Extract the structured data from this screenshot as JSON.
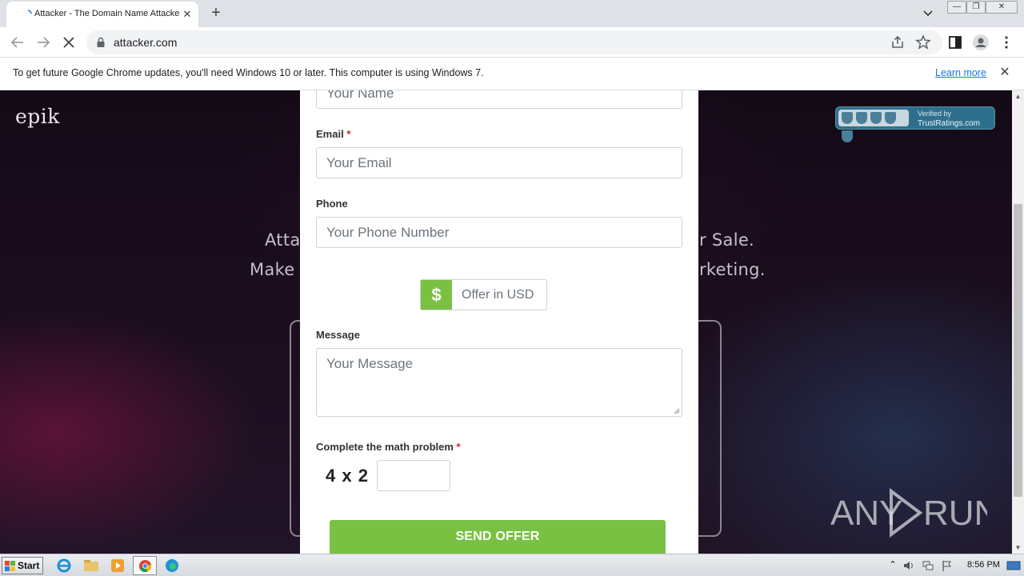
{
  "browser": {
    "tab_title": "Attacker - The Domain Name Attacker",
    "new_tab_symbol": "+",
    "tab_close_symbol": "✕",
    "url": "attacker.com",
    "window_buttons": [
      "—",
      "❐",
      "✕"
    ]
  },
  "infobar": {
    "message": "To get future Google Chrome updates, you'll need Windows 10 or later. This computer is using Windows 7.",
    "link": "Learn more",
    "close_symbol": "✕"
  },
  "page": {
    "logo": "epik",
    "trust_badge": {
      "line1": "Verified by",
      "line2": "TrustRatings.com"
    },
    "headline_left": "Attac",
    "headline_right": "r Sale.",
    "subline_left": "Make Y",
    "subline_right": "rketing.",
    "watermark": "ANY RUN"
  },
  "form": {
    "name_placeholder": "Your Name",
    "email_label": "Email",
    "email_placeholder": "Your Email",
    "required_mark": "*",
    "phone_label": "Phone",
    "phone_placeholder": "Your Phone Number",
    "currency_symbol": "$",
    "offer_placeholder": "Offer in USD",
    "message_label": "Message",
    "message_placeholder": "Your Message",
    "math_label": "Complete the math problem",
    "math_question": "4 x 2",
    "submit_label": "SEND OFFER"
  },
  "taskbar": {
    "start_label": "Start",
    "clock": "8:56 PM"
  },
  "colors": {
    "accent_green": "#7ac143",
    "required_red": "#d9232d",
    "link_blue": "#1a73e8"
  }
}
